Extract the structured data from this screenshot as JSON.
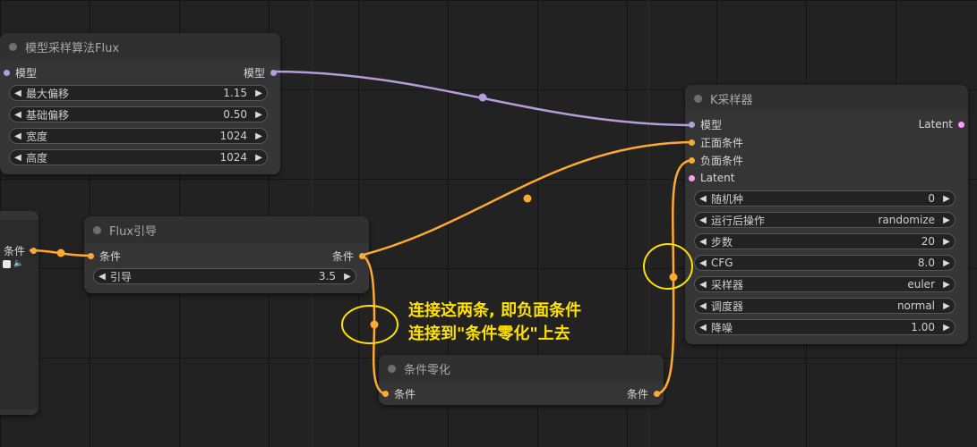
{
  "colors": {
    "model": "#b39ddb",
    "conditioning": "#ffa931",
    "latent": "#ff9cf9",
    "annotation": "#ffe100"
  },
  "flux_sampling_node": {
    "title": "模型采样算法Flux",
    "input_label": "模型",
    "output_label": "模型",
    "widgets": [
      {
        "label": "最大偏移",
        "value": "1.15"
      },
      {
        "label": "基础偏移",
        "value": "0.50"
      },
      {
        "label": "宽度",
        "value": "1024"
      },
      {
        "label": "高度",
        "value": "1024"
      }
    ]
  },
  "left_partial_node": {
    "output_label": "条件"
  },
  "flux_guidance_node": {
    "title": "Flux引导",
    "input_label": "条件",
    "output_label": "条件",
    "widgets": [
      {
        "label": "引导",
        "value": "3.5"
      }
    ]
  },
  "ksampler_node": {
    "title": "K采样器",
    "inputs": [
      "模型",
      "正面条件",
      "负面条件",
      "Latent"
    ],
    "output_label": "Latent",
    "widgets": [
      {
        "label": "随机种",
        "value": "0"
      },
      {
        "label": "运行后操作",
        "value": "randomize"
      },
      {
        "label": "步数",
        "value": "20"
      },
      {
        "label": "CFG",
        "value": "8.0"
      },
      {
        "label": "采样器",
        "value": "euler"
      },
      {
        "label": "调度器",
        "value": "normal"
      },
      {
        "label": "降噪",
        "value": "1.00"
      }
    ]
  },
  "zero_out_node": {
    "title": "条件零化",
    "input_label": "条件",
    "output_label": "条件"
  },
  "annotation": {
    "line1": "连接这两条, 即负面条件",
    "line2": "连接到\"条件零化\"上去"
  }
}
